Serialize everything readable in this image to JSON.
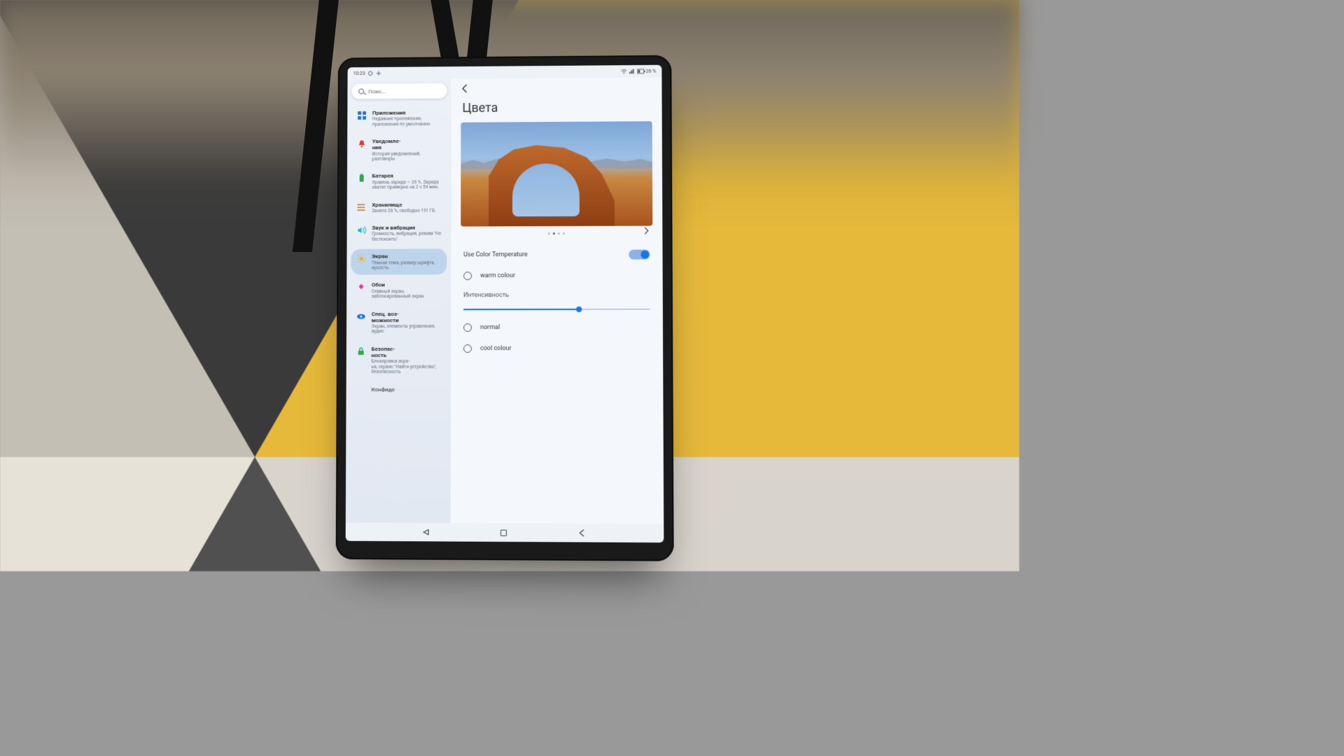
{
  "statusbar": {
    "time": "10:23",
    "battery_text": "26 %"
  },
  "search": {
    "placeholder": "Поис..."
  },
  "sidebar": {
    "items": [
      {
        "title": "Приложения",
        "sub": "Недавние приложения, приложения по умолчанию"
      },
      {
        "title": "Уведомле-\nния",
        "sub": "История уведомлений, разговоры"
      },
      {
        "title": "Батарея",
        "sub": "Уровень заряда — 26 %. Заряда хватит примерно на 2 ч 54 мин."
      },
      {
        "title": "Хранилище",
        "sub": "Занято 26 %, свободно 191 ГБ"
      },
      {
        "title": "Звук и вибрация",
        "sub": "Громкость, вибрация, режим \"Не беспокоить\""
      },
      {
        "title": "Экран",
        "sub": "Тёмная тема, размер шрифта, яркость"
      },
      {
        "title": "Обои",
        "sub": "Главный экран, заблокированный экран"
      },
      {
        "title": "Спец. воз-\nможности",
        "sub": "Экран, элементы управления, аудио"
      },
      {
        "title": "Безопас-\nность",
        "sub": "Блокировка экра-\nна, сервис \"Найти устройство\", безопасность"
      },
      {
        "title": "Конфиде",
        "sub": ""
      }
    ],
    "active_index": 5
  },
  "detail": {
    "title": "Цвета",
    "use_color_temperature_label": "Use Color Temperature",
    "use_color_temperature_on": true,
    "radio_options": [
      {
        "label": "warm colour"
      },
      {
        "label": "normal"
      },
      {
        "label": "cool colour"
      }
    ],
    "intensity_label": "Интенсивность",
    "intensity_value_pct": 62
  },
  "colors": {
    "accent": "#1a73e8",
    "sidebar_active": "#bcd4ec"
  }
}
